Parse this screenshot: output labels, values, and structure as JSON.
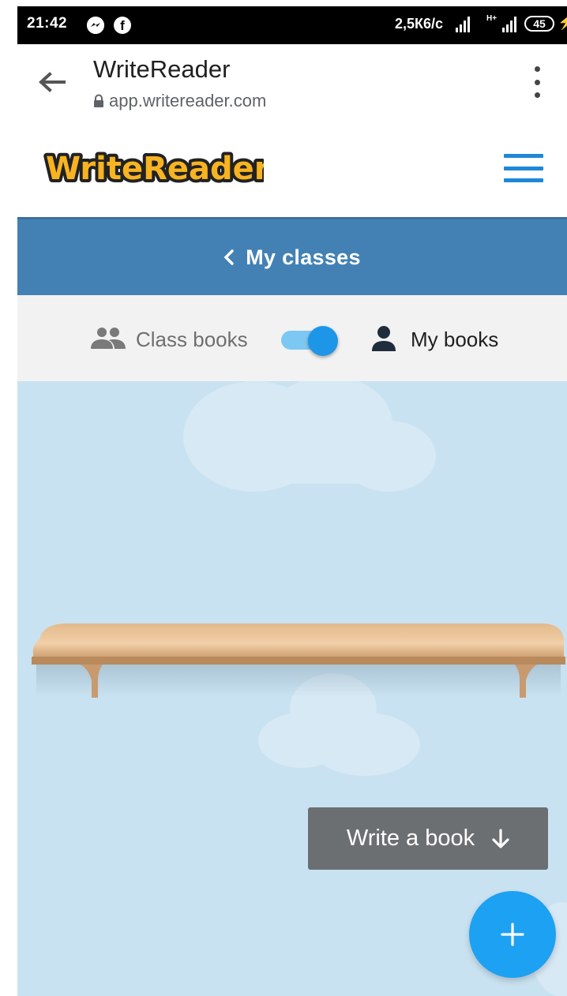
{
  "status_bar": {
    "time": "21:42",
    "network_speed": "2,5К6/с",
    "network_type": "H+",
    "battery": "45"
  },
  "browser": {
    "title": "WriteReader",
    "url": "app.writereader.com"
  },
  "app": {
    "logo_text": "WriteReader",
    "accent_color": "#1e88d6"
  },
  "class_bar": {
    "label": "My classes",
    "color": "#4381b4"
  },
  "toggle": {
    "left_label": "Class books",
    "right_label": "My books",
    "state": "My books"
  },
  "tooltip": {
    "label": "Write a book"
  },
  "fab": {
    "icon": "plus-icon",
    "color": "#1da1f2"
  },
  "icons": {
    "back": "arrow-left-icon",
    "lock": "lock-icon",
    "more": "kebab-menu-icon",
    "menu": "hamburger-menu-icon",
    "class_books": "group-icon",
    "my_books": "person-icon",
    "tooltip_arrow": "arrow-down-icon"
  }
}
